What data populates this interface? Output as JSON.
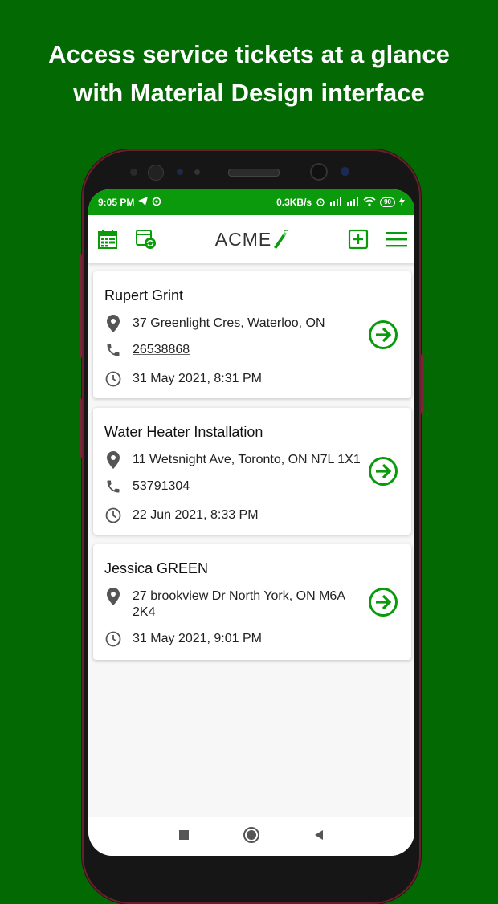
{
  "headline": {
    "line1": "Access service tickets at a glance",
    "line2": "with Material Design interface"
  },
  "status_bar": {
    "time": "9:05 PM",
    "net_speed": "0.3KB/s",
    "battery": "90"
  },
  "app_bar": {
    "logo_text": "ACME",
    "accent_color": "#0b9a0b"
  },
  "tickets": [
    {
      "title": "Rupert Grint",
      "address": "37 Greenlight Cres, Waterloo, ON",
      "phone": "26538868",
      "datetime": "31 May 2021, 8:31 PM"
    },
    {
      "title": "Water Heater Installation",
      "address": "11 Wetsnight Ave, Toronto, ON N7L 1X1",
      "phone": "53791304",
      "datetime": "22 Jun 2021, 8:33 PM"
    },
    {
      "title": "Jessica GREEN",
      "address": "27 brookview Dr North York, ON M6A 2K4",
      "datetime": "31 May 2021, 9:01 PM"
    }
  ]
}
